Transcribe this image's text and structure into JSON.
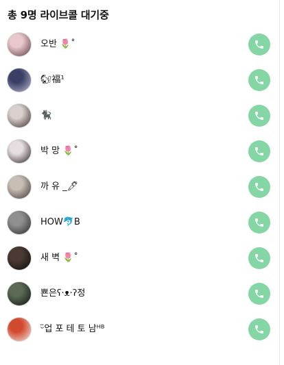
{
  "header": {
    "title": "총 9명 라이브콜 대기중"
  },
  "colors": {
    "call_button": "#84d6a5",
    "call_icon": "#ffffff"
  },
  "icons": {
    "call": "phone-icon"
  },
  "queue": [
    {
      "name": "오반 🌷˚",
      "avatar_colors": [
        "#e8c8cc",
        "#5a3a40"
      ]
    },
    {
      "name": "🐿福¹",
      "avatar_colors": [
        "#3a3f66",
        "#b8b8d0"
      ]
    },
    {
      "name": "🐈‍⬛",
      "avatar_colors": [
        "#d9cfcc",
        "#3b2f2c"
      ]
    },
    {
      "name": "박 망 🌷˚",
      "avatar_colors": [
        "#e6dde0",
        "#2b2426"
      ]
    },
    {
      "name": "까 유 _🖊",
      "avatar_colors": [
        "#c7bfb6",
        "#3d3530"
      ]
    },
    {
      "name": "HOW🐬B",
      "avatar_colors": [
        "#8f8f8f",
        "#2a2a2a"
      ]
    },
    {
      "name": "새 벽 🌷˚",
      "avatar_colors": [
        "#4a3a33",
        "#0d0b0a"
      ]
    },
    {
      "name": "뾴은ʕ·ᴥ·ʔ정",
      "avatar_colors": [
        "#5a6a55",
        "#0e0f0c"
      ]
    },
    {
      "name": "ᵕ̈업 포 테 토 남ᴴᴮ",
      "avatar_colors": [
        "#d24a2e",
        "#f2e6e0"
      ]
    }
  ]
}
